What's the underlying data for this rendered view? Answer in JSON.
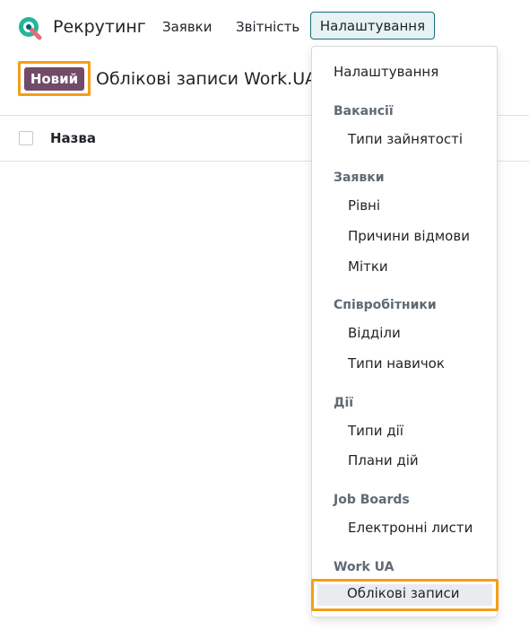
{
  "navbar": {
    "app_name": "Рекрутинг",
    "menu": [
      "Заявки",
      "Звітність",
      "Налаштування"
    ]
  },
  "control": {
    "new_button": "Новий",
    "breadcrumb": "Облікові записи Work.UA"
  },
  "list": {
    "column_name": "Назва"
  },
  "dropdown": {
    "top_item": "Налаштування",
    "sections": [
      {
        "title": "Вакансії",
        "items": [
          "Типи зайнятості"
        ]
      },
      {
        "title": "Заявки",
        "items": [
          "Рівні",
          "Причини відмови",
          "Мітки"
        ]
      },
      {
        "title": "Співробітники",
        "items": [
          "Відділи",
          "Типи навичок"
        ]
      },
      {
        "title": "Дії",
        "items": [
          "Типи дії",
          "Плани дій"
        ]
      },
      {
        "title": "Job Boards",
        "items": [
          "Електронні листи"
        ]
      },
      {
        "title": "Work UA",
        "items": [
          "Облікові записи"
        ]
      }
    ]
  },
  "colors": {
    "accent": "#714b67",
    "highlight": "#f59e17",
    "active_menu_border": "#1a6b79"
  }
}
